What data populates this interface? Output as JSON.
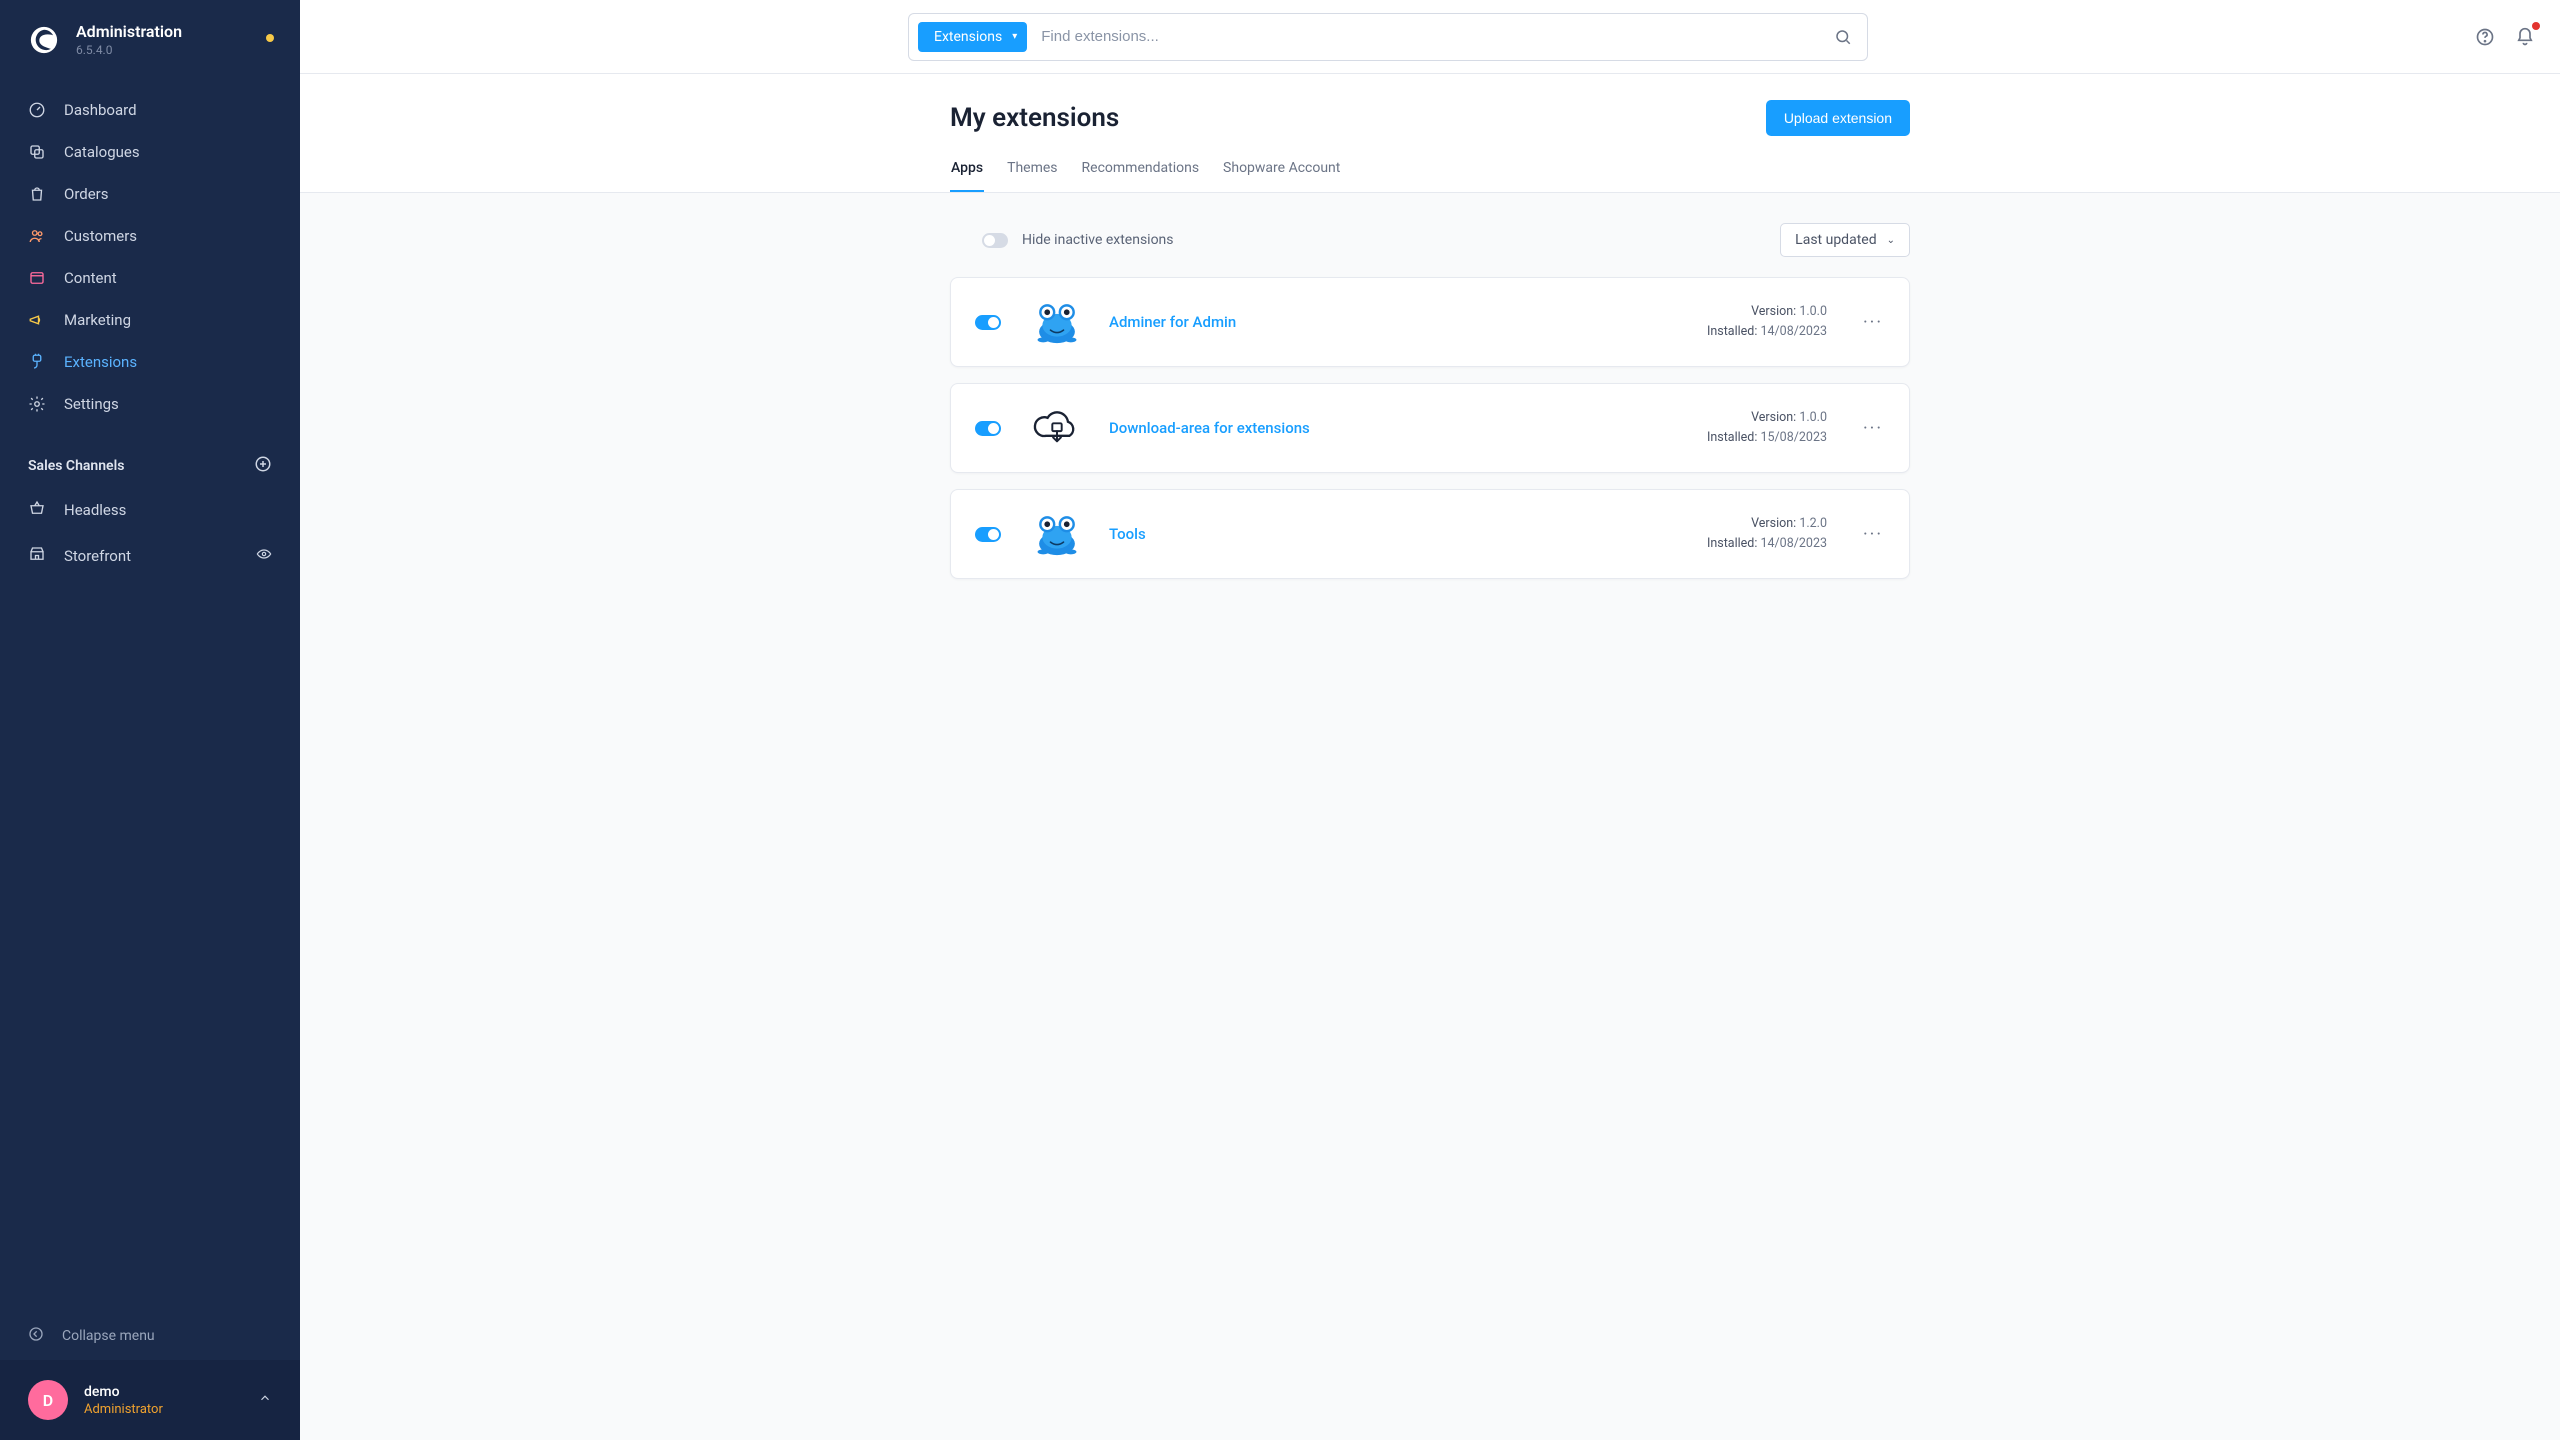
{
  "brand": {
    "title": "Administration",
    "version": "6.5.4.0"
  },
  "nav": [
    {
      "key": "dashboard",
      "label": "Dashboard",
      "active": false,
      "icon": "gauge"
    },
    {
      "key": "catalogues",
      "label": "Catalogues",
      "active": false,
      "icon": "layers"
    },
    {
      "key": "orders",
      "label": "Orders",
      "active": false,
      "icon": "bag"
    },
    {
      "key": "customers",
      "label": "Customers",
      "active": false,
      "icon": "users"
    },
    {
      "key": "content",
      "label": "Content",
      "active": false,
      "icon": "window"
    },
    {
      "key": "marketing",
      "label": "Marketing",
      "active": false,
      "icon": "megaphone"
    },
    {
      "key": "extensions",
      "label": "Extensions",
      "active": true,
      "icon": "plug"
    },
    {
      "key": "settings",
      "label": "Settings",
      "active": false,
      "icon": "gear"
    }
  ],
  "salesChannels": {
    "header": "Sales Channels",
    "items": [
      {
        "key": "headless",
        "label": "Headless",
        "icon": "basket"
      },
      {
        "key": "storefront",
        "label": "Storefront",
        "icon": "store",
        "hasVisibility": true
      }
    ]
  },
  "collapse": {
    "label": "Collapse menu"
  },
  "user": {
    "initial": "D",
    "name": "demo",
    "role": "Administrator"
  },
  "search": {
    "scope": "Extensions",
    "placeholder": "Find extensions..."
  },
  "page": {
    "title": "My extensions",
    "uploadLabel": "Upload extension",
    "tabs": [
      {
        "key": "apps",
        "label": "Apps",
        "active": true
      },
      {
        "key": "themes",
        "label": "Themes",
        "active": false
      },
      {
        "key": "recommendations",
        "label": "Recommendations",
        "active": false
      },
      {
        "key": "account",
        "label": "Shopware Account",
        "active": false
      }
    ],
    "hideInactiveLabel": "Hide inactive extensions",
    "sortLabel": "Last updated",
    "versionLabel": "Version:",
    "installedLabel": "Installed:"
  },
  "extensions": [
    {
      "name": "Adminer for Admin",
      "version": "1.0.0",
      "installed": "14/08/2023",
      "icon": "frog",
      "active": true
    },
    {
      "name": "Download-area for extensions",
      "version": "1.0.0",
      "installed": "15/08/2023",
      "icon": "cloud",
      "active": true
    },
    {
      "name": "Tools",
      "version": "1.2.0",
      "installed": "14/08/2023",
      "icon": "frog",
      "active": true
    }
  ],
  "colors": {
    "accent": "#189eff",
    "sidebar": "#1a2a4a"
  }
}
